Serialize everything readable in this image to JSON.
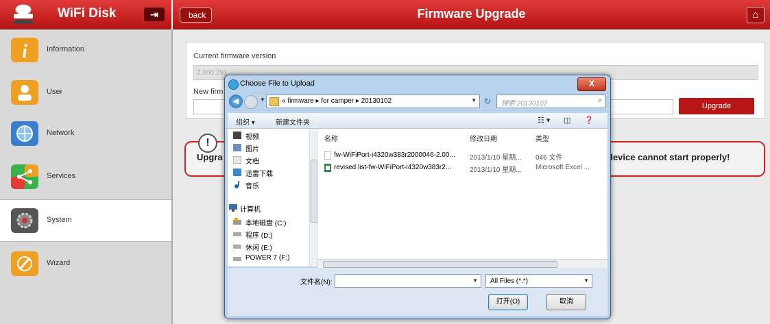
{
  "app": {
    "title": "WiFi Disk",
    "logout_glyph": "⇥"
  },
  "header": {
    "back_label": "back",
    "page_title": "Firmware Upgrade",
    "home_glyph": "⌂"
  },
  "sidebar": {
    "items": [
      {
        "label": "Information",
        "icon": "info-icon",
        "color": "#f0a020"
      },
      {
        "label": "User",
        "icon": "user-icon",
        "color": "#f0a020"
      },
      {
        "label": "Network",
        "icon": "globe-icon",
        "color": "#3a7ecf"
      },
      {
        "label": "Services",
        "icon": "share-icon",
        "color": "#3cb34a"
      },
      {
        "label": "System",
        "icon": "gear-icon",
        "color": "#555555"
      },
      {
        "label": "Wizard",
        "icon": "wand-icon",
        "color": "#f0a020"
      }
    ],
    "active": "System"
  },
  "firmware": {
    "current_label": "Current firmware version",
    "current_value": "2.000.291",
    "new_label_visible": "New firm",
    "upgrade_label": "Upgrade"
  },
  "warning": {
    "glyph": "!",
    "text_left": "Upgra",
    "text_right": "device cannot start properly!"
  },
  "dialog": {
    "title": "Choose File to Upload",
    "close_glyph": "X",
    "path_prefix": "«",
    "path": "firmware  ▸  for camper  ▸  20130102",
    "search_placeholder": "搜索 20130102",
    "toolbar": {
      "organize": "组织 ▾",
      "new_folder": "新建文件夹"
    },
    "nav_items": [
      "视频",
      "图片",
      "文档",
      "迅雷下载",
      "音乐",
      "计算机",
      "本地磁盘 (C:)",
      "程序 (D:)",
      "休闲 (E:)",
      "POWER 7 (F:)"
    ],
    "columns": {
      "name": "名称",
      "date": "修改日期",
      "type": "类型"
    },
    "files": [
      {
        "name": "fw-WiFiPort-i4320w383r2000046-2.00...",
        "date": "2013/1/10 星期...",
        "type": "046 文件"
      },
      {
        "name": "revised list-fw-WiFiPort-i4320w383r2...",
        "date": "2013/1/10 星期...",
        "type": "Microsoft Excel ..."
      }
    ],
    "filename_label": "文件名(N):",
    "filetype_value": "All Files (*.*)",
    "open_label": "打开(O)",
    "cancel_label": "取消"
  },
  "colors": {
    "brand_red": "#c41a1a",
    "sidebar_bg": "#d9d9d9",
    "dialog_frame": "#b9d3ec"
  }
}
